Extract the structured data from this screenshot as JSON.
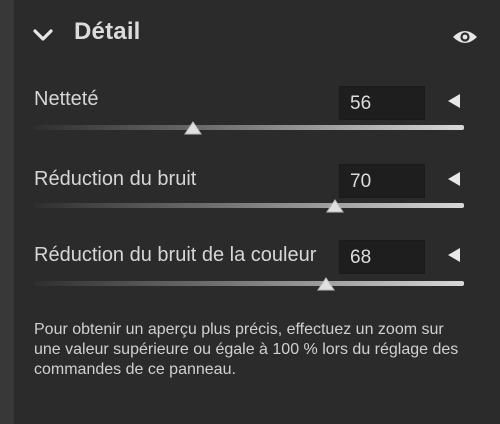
{
  "panel": {
    "title": "Détail",
    "collapse_icon": "chevron-down-icon",
    "visibility_icon": "eye-icon"
  },
  "controls": [
    {
      "label": "Netteté",
      "value": "56",
      "level": 0.37
    },
    {
      "label": "Réduction du bruit",
      "value": "70",
      "level": 0.7
    },
    {
      "label": "Réduction du bruit de la couleur",
      "value": "68",
      "level": 0.68
    }
  ],
  "note": "Pour obtenir un aperçu plus précis, effectuez un zoom sur une valeur supérieure ou égale à 100 % lors du réglage des commandes de ce panneau.",
  "colors": {
    "panel_bg": "#2b2b2b",
    "outer_bg": "#383838",
    "text": "#d6d6d6",
    "field_bg": "#1e1e1e"
  }
}
